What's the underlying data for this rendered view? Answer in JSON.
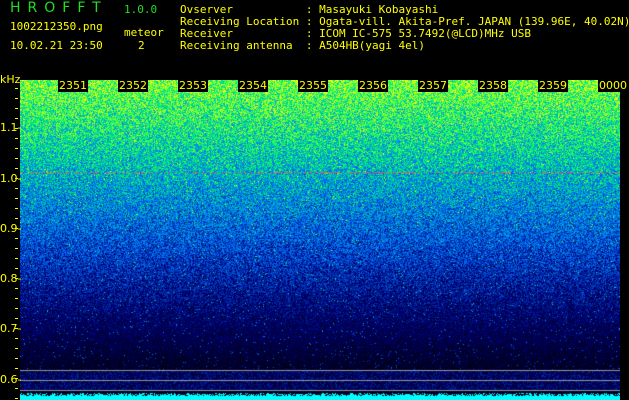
{
  "header": {
    "app_title": "HROFFT",
    "version": "1.0.0",
    "filename": "1002212350.png",
    "datetime": "10.02.21 23:50",
    "meteor_label": "meteor",
    "meteor_count": "2"
  },
  "info": [
    {
      "label": "Ovserver           : Masayuki Kobayashi"
    },
    {
      "label": "Receiving Location : Ogata-vill. Akita-Pref. JAPAN (139.96E, 40.02N)"
    },
    {
      "label": "Receiver           : ICOM IC-575 53.7492(@LCD)MHz USB"
    },
    {
      "label": "Receiving antenna  : A504HB(yagi 4el)"
    }
  ],
  "spectrogram": {
    "y_unit": "kHz",
    "y_labels": [
      "1.1",
      "1.0",
      "0.9",
      "0.8",
      "0.7",
      "0.6"
    ],
    "time_labels": [
      "2351",
      "2352",
      "2353",
      "2354",
      "2355",
      "2356",
      "2357",
      "2358",
      "2359",
      "0000"
    ],
    "colors": {
      "text": "#ffff00",
      "title": "#22dd22",
      "low": "#000033",
      "mid": "#0000ff",
      "high": "#00ff66",
      "baseline": "#00ffff"
    }
  }
}
